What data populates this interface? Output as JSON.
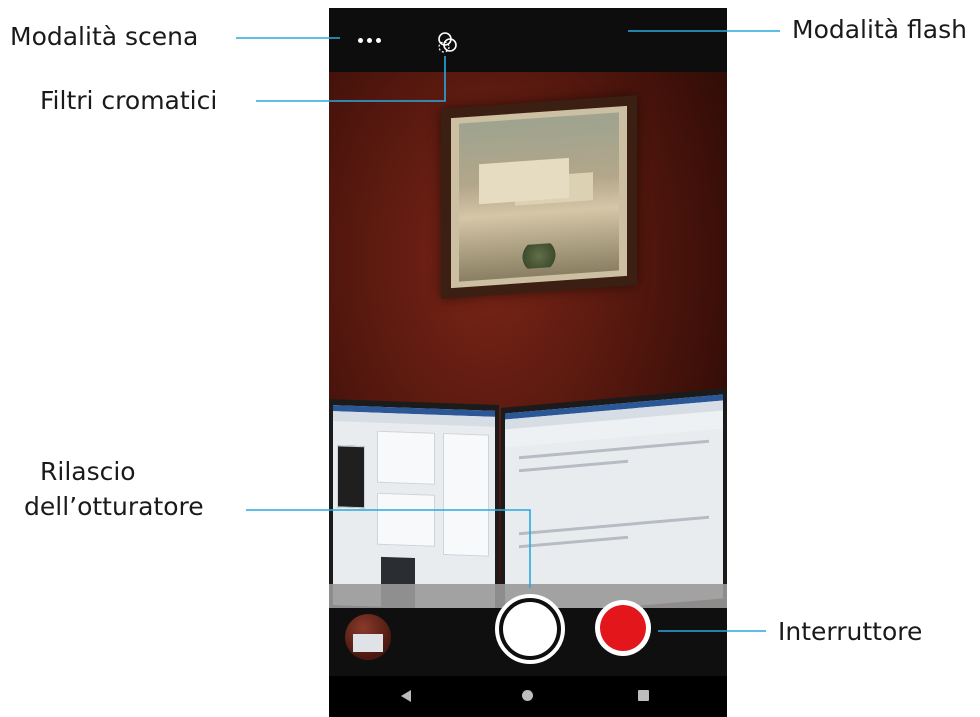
{
  "labels": {
    "scene_mode": "Modalità scena",
    "color_filters": "Filtri cromatici",
    "flash_mode": "Modalità flash",
    "shutter_release_line1": "Rilascio",
    "shutter_release_line2": "dell’otturatore",
    "switch": "Interruttore"
  },
  "camera": {
    "top_bar": {
      "scene_icon": "more-horiz-icon",
      "filter_icon": "color-filter-icon"
    },
    "bottom_bar": {
      "gallery_icon": "gallery-thumbnail",
      "shutter_icon": "shutter-button",
      "record_icon": "video-record-toggle"
    },
    "nav": {
      "back_icon": "back-icon",
      "home_icon": "home-icon",
      "recent_icon": "recents-icon"
    }
  },
  "colors": {
    "callout_line": "#29a9e0",
    "record": "#e3161b",
    "bar": "#0d0d0d"
  }
}
